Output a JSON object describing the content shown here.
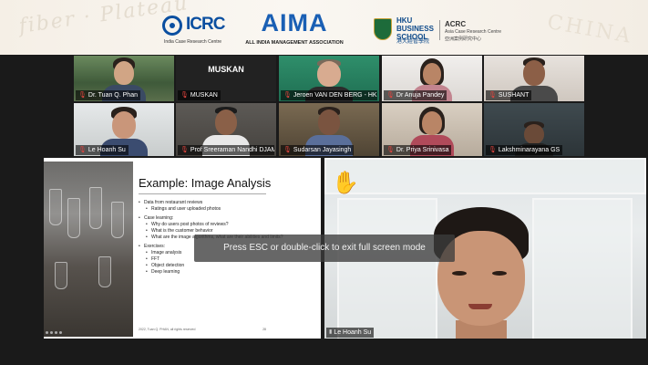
{
  "banner": {
    "icrc": {
      "name": "ICRC",
      "subtitle": "India Case Research Centre"
    },
    "aima": {
      "name": "AIMA",
      "subtitle": "ALL INDIA MANAGEMENT ASSOCIATION"
    },
    "hku": {
      "name": "HKU BUSINESS SCHOOL",
      "chinese": "港大經管學院"
    },
    "acrc": {
      "name": "ACRC",
      "subtitle": "Asia Case Research Centre",
      "chinese": "亞洲案例研究中心"
    }
  },
  "participants": [
    {
      "name": "Dr. Tuan Q. Phan",
      "muted": true,
      "active": true
    },
    {
      "name": "MUSKAN",
      "muted": true,
      "video": false,
      "display": "MUSKAN"
    },
    {
      "name": "Jeroen VAN DEN BERG - HKU...",
      "muted": true
    },
    {
      "name": "Dr Anuja Pandey",
      "muted": true
    },
    {
      "name": "SUSHANT",
      "muted": true
    },
    {
      "name": "Le Hoanh Su",
      "muted": true
    },
    {
      "name": "Prof Sreeraman Nandhi DJAME",
      "muted": true
    },
    {
      "name": "Sudarsan Jayasingh",
      "muted": true
    },
    {
      "name": "Dr. Priya Srinivasa",
      "muted": true
    },
    {
      "name": "Lakshminarayana GS",
      "muted": true
    }
  ],
  "slide": {
    "title": "Example: Image Analysis",
    "bullets": [
      {
        "text": "Data from restaurant reviews",
        "level": 1
      },
      {
        "text": "Ratings and user uploaded photos",
        "level": 2
      },
      {
        "text": "Case learning:",
        "level": 1
      },
      {
        "text": "Why do users post photos of reviews?",
        "level": 2
      },
      {
        "text": "What is the customer behavior",
        "level": 2
      },
      {
        "text": "What are the image algorithms, what are their abilities and limits?",
        "level": 2
      },
      {
        "text": "Exercises:",
        "level": 1
      },
      {
        "text": "Image analysis",
        "level": 2
      },
      {
        "text": "FFT",
        "level": 2
      },
      {
        "text": "Object detection",
        "level": 2
      },
      {
        "text": "Deep learning",
        "level": 2
      }
    ],
    "footer_left": "2022, Tuan Q. PHAN, all rights reserved",
    "page_number": "28"
  },
  "speaker": {
    "name": "Le Hoanh Su",
    "muted": false,
    "reaction": "raise-hand",
    "reaction_color": "#f4b400"
  },
  "fullscreen_notice": "Press ESC or double-click to exit full screen mode",
  "colors": {
    "active_outline": "#c8e07a",
    "mute_icon": "#e0443e",
    "brand_blue": "#1a5fb4"
  }
}
